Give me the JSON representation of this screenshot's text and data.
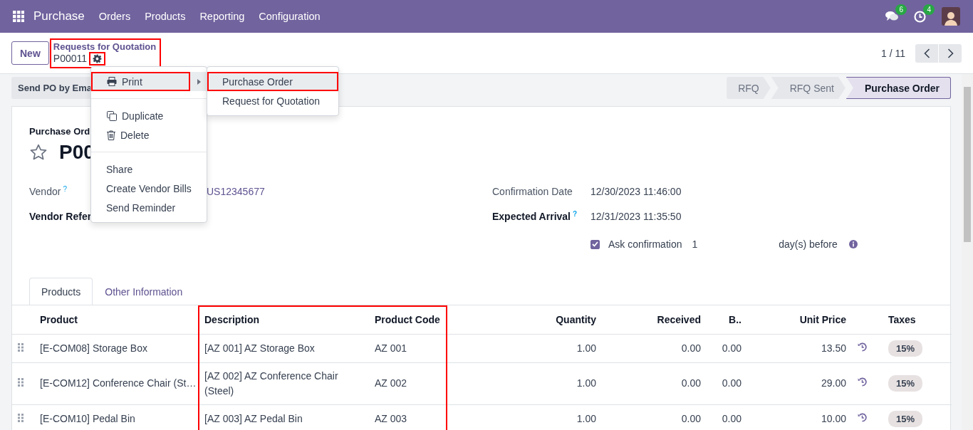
{
  "navbar": {
    "app": "Purchase",
    "menu": [
      "Orders",
      "Products",
      "Reporting",
      "Configuration"
    ],
    "messages_count": "6",
    "activities_count": "4"
  },
  "control_panel": {
    "new_button": "New",
    "breadcrumb_parent": "Requests for Quotation",
    "breadcrumb_current": "P00011",
    "breadcrumb_annotated": true,
    "gear_annotated": true,
    "pager": "1 / 11"
  },
  "action_menu": [
    {
      "kind": "print",
      "label": "Print",
      "selected": true,
      "annotated": true
    },
    {
      "kind": "divider"
    },
    {
      "kind": "duplicate",
      "label": "Duplicate",
      "selected": false,
      "annotated": false
    },
    {
      "kind": "delete",
      "label": "Delete",
      "selected": false,
      "annotated": false
    },
    {
      "kind": "divider"
    },
    {
      "kind": "plain",
      "label": "Share",
      "selected": false,
      "annotated": false
    },
    {
      "kind": "plain",
      "label": "Create Vendor Bills",
      "selected": false,
      "annotated": false
    },
    {
      "kind": "plain",
      "label": "Send Reminder",
      "selected": false,
      "annotated": false
    }
  ],
  "print_menu": [
    {
      "label": "Purchase Order",
      "selected": true,
      "annotated": true
    },
    {
      "label": "Request for Quotation",
      "selected": false,
      "annotated": false
    }
  ],
  "action_button": "Send PO by Ema",
  "stages": [
    {
      "label": "RFQ",
      "selected": false
    },
    {
      "label": "RFQ Sent",
      "selected": false
    },
    {
      "label": "Purchase Order",
      "selected": true
    }
  ],
  "form": {
    "title_label": "Purchase Ord",
    "starred": false,
    "name": "P00",
    "fields_left": [
      {
        "label": "Vendor",
        "help": "?",
        "value": "US12345677",
        "bold": false
      },
      {
        "label": "Vendor Refer",
        "bold": true
      }
    ],
    "fields_right": [
      {
        "label": "Confirmation Date",
        "value": "12/30/2023 11:46:00",
        "bold": false
      },
      {
        "label": "Expected Arrival",
        "help": "?",
        "value": "12/31/2023 11:35:50",
        "bold": true
      }
    ],
    "ask_confirmation": {
      "label": "Ask confirmation",
      "checked": true,
      "days": "1",
      "suffix": "day(s) before"
    }
  },
  "tabs": [
    {
      "label": "Products",
      "selected": true
    },
    {
      "label": "Other Information",
      "selected": false
    }
  ],
  "table": {
    "columns": [
      {
        "label": "Product",
        "annotated": false
      },
      {
        "label": "Description",
        "annotated": true
      },
      {
        "label": "Product Code",
        "annotated": true
      },
      {
        "label": "Quantity",
        "annotated": false
      },
      {
        "label": "Received",
        "annotated": false
      },
      {
        "label": "B..",
        "annotated": false
      },
      {
        "label": "Unit Price",
        "annotated": false
      },
      {
        "label": "Taxes",
        "annotated": false
      }
    ],
    "rows": [
      {
        "product": "[E-COM08] Storage Box",
        "description": "[AZ 001] AZ Storage Box",
        "product_code": "AZ 001",
        "quantity": "1.00",
        "received": "0.00",
        "billed": "0.00",
        "unit_price": "13.50",
        "taxes": "15%"
      },
      {
        "product": "[E-COM12] Conference Chair (St…",
        "description": "[AZ 002] AZ Conference Chair (Steel)",
        "product_code": "AZ 002",
        "quantity": "1.00",
        "received": "0.00",
        "billed": "0.00",
        "unit_price": "29.00",
        "taxes": "15%"
      },
      {
        "product": "[E-COM10] Pedal Bin",
        "description": "[AZ 003] AZ Pedal Bin",
        "product_code": "AZ 003",
        "quantity": "1.00",
        "received": "0.00",
        "billed": "0.00",
        "unit_price": "10.00",
        "taxes": "15%"
      }
    ]
  }
}
